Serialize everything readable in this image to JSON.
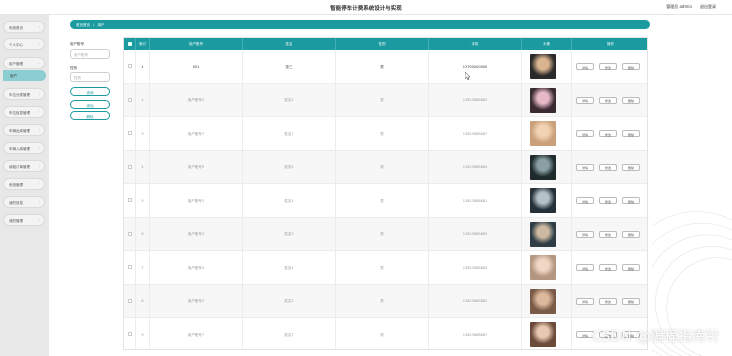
{
  "header": {
    "title": "智能停车计费系统设计与实现",
    "user": "管理员 admin",
    "logout": "退出登录"
  },
  "sidebar": {
    "items": [
      {
        "label": "系统首页"
      },
      {
        "label": "个人中心"
      },
      {
        "label": "用户管理"
      },
      {
        "label": "用户",
        "sub": true
      },
      {
        "label": "车位分类管理"
      },
      {
        "label": "车位信息管理"
      },
      {
        "label": "车辆出库管理"
      },
      {
        "label": "车辆入库管理"
      },
      {
        "label": "续租订单管理"
      },
      {
        "label": "系统管理"
      },
      {
        "label": "我的信息"
      },
      {
        "label": "我的管理"
      }
    ]
  },
  "breadcrumb": {
    "home": "首页首页",
    "separator": "/",
    "current": "用户"
  },
  "filters": {
    "account_label": "用户账号",
    "account_placeholder": "用户账号",
    "gender_label": "性别",
    "gender_placeholder": "性别",
    "search_button": "查询",
    "add_button": "添加",
    "delete_button": "删除"
  },
  "table": {
    "columns": [
      "",
      "索引",
      "用户账号",
      "姓名",
      "性别",
      "手机",
      "头像",
      "操作"
    ],
    "actions": [
      "详情",
      "修改",
      "删除"
    ],
    "rows": [
      {
        "index": "1",
        "account": "001",
        "name": "张三",
        "gender": "男",
        "phone": "13700000000"
      },
      {
        "index": "2",
        "account": "用户账号2",
        "name": "姓名2",
        "gender": "男",
        "phone": "13823888882"
      },
      {
        "index": "3",
        "account": "用户账号7",
        "name": "姓名7",
        "gender": "男",
        "phone": "13823888887"
      },
      {
        "index": "4",
        "account": "用户账号5",
        "name": "姓名5",
        "gender": "男",
        "phone": "13823888885"
      },
      {
        "index": "5",
        "account": "用户账号1",
        "name": "姓名1",
        "gender": "男",
        "phone": "13823888881"
      },
      {
        "index": "6",
        "account": "用户账号3",
        "name": "姓名3",
        "gender": "男",
        "phone": "13823888883"
      },
      {
        "index": "7",
        "account": "用户账号4",
        "name": "姓名4",
        "gender": "男",
        "phone": "13823888884"
      },
      {
        "index": "8",
        "account": "用户账号2",
        "name": "姓名2",
        "gender": "男",
        "phone": "13823888882"
      },
      {
        "index": "9",
        "account": "用户账号7",
        "name": "姓名7",
        "gender": "男",
        "phone": "13823888887"
      }
    ]
  },
  "watermark": "CSDN @编程指南针",
  "colors": {
    "accent": "#1b9aa0",
    "sub_menu": "#8ccdd2"
  }
}
